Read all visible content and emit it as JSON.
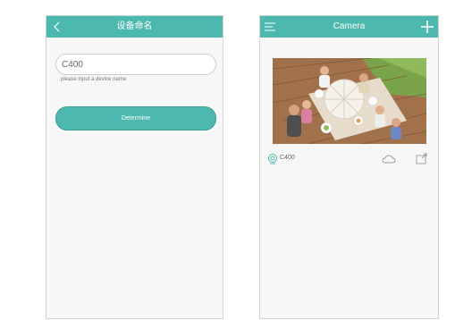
{
  "left_screen": {
    "title": "设备命名",
    "input_value": "C400",
    "hint": "please input a device name",
    "button_label": "Determine"
  },
  "right_screen": {
    "title": "Camera",
    "devices": [
      {
        "name": "C400"
      }
    ]
  },
  "colors": {
    "accent": "#4db8ad"
  },
  "icons": [
    "back-arrow-icon",
    "menu-icon",
    "plus-icon",
    "camera-status-icon",
    "cloud-icon",
    "share-icon"
  ]
}
